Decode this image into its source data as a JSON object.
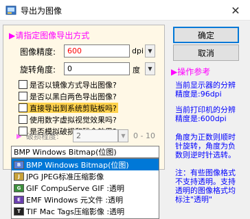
{
  "window": {
    "title": "导出为图像",
    "close_glyph": "✕"
  },
  "group": {
    "title": "▶请指定图像导出方式"
  },
  "precision": {
    "label": "图像精度:",
    "value": "600",
    "unit": "dpi",
    "spin_glyph": "▼"
  },
  "rotation": {
    "label": "旋转角度:",
    "value": "0",
    "unit": "度",
    "spin_glyph": "▼"
  },
  "options": [
    {
      "label": "是否以镜像方式导出图像?",
      "checked": false
    },
    {
      "label": "是否以黑白两色导出图像?",
      "checked": false
    },
    {
      "label": "直接导出到系统剪贴板吗?",
      "checked": false,
      "highlighted": true
    },
    {
      "label": "使用数字虚拟视觉效果吗?",
      "checked": false
    },
    {
      "label": "是否模拟破损和残余效果?",
      "checked": false
    }
  ],
  "damage": {
    "arrow": "▶",
    "label": "破损程度:",
    "value": "2",
    "spin_glyph": "▼",
    "range": "0 - 10"
  },
  "format": {
    "selected": "BMP Windows Bitmap(位图)",
    "items": [
      {
        "label": "BMP Windows Bitmap(位图)",
        "icon": "bmp-icon",
        "selected": true
      },
      {
        "label": "JPG JPEG标准压缩影像",
        "icon": "jpg-icon",
        "selected": false
      },
      {
        "label": "GIF CompuServe GIF :透明",
        "icon": "gif-icon",
        "selected": false
      },
      {
        "label": "EMF Windows 元文件 :透明",
        "icon": "emf-icon",
        "selected": false
      },
      {
        "label": "TIF Mac Tags压缩影像 :透明",
        "icon": "tif-icon",
        "selected": false
      }
    ]
  },
  "buttons": {
    "ok": "确定",
    "cancel": "取消"
  },
  "reference": {
    "title": "▶操作参考",
    "note1_line1": "当前显示器的分辨",
    "note1_line2": "精度是:96dpi",
    "note2_line1": "当前打印机的分辨",
    "note2_line2": "精度是:600dpi",
    "note3_line1": "角度为正数则顺时",
    "note3_line2": "针旋转，角度为负",
    "note3_line3": "数则逆时针选转。",
    "note4_line1": "注：有些图像格式",
    "note4_line2": "不支持透明。支持",
    "note4_line3": "透明的图像格式均",
    "note4_line4": "标注\"透明\""
  },
  "colors": {
    "accent": "#ff00ff",
    "note_text": "#0000ff",
    "value_red": "#ff0000",
    "selection": "#0078d7",
    "highlight": "#ffd24d",
    "group_bg": "#fff8e6"
  }
}
